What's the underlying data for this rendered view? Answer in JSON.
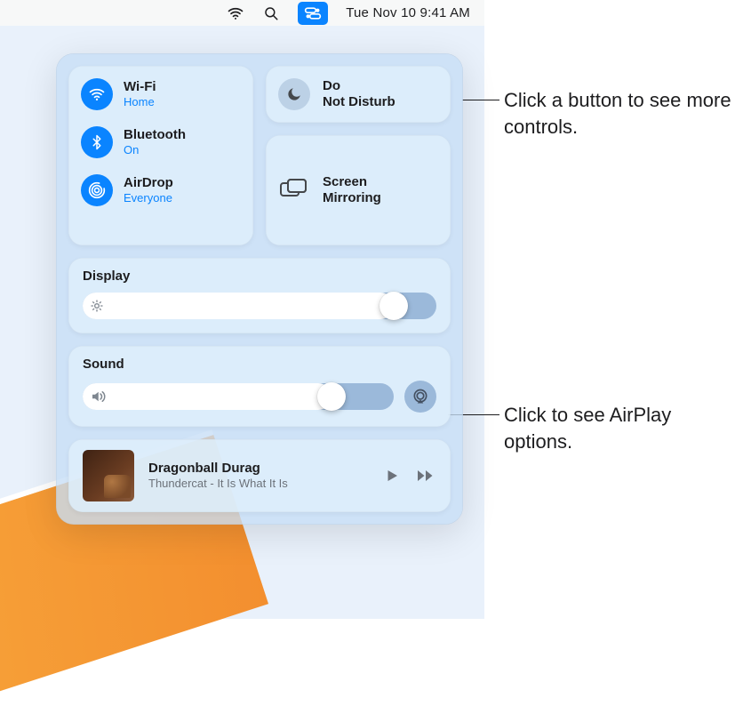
{
  "menubar": {
    "datetime": "Tue Nov 10  9:41 AM"
  },
  "cc": {
    "wifi": {
      "title": "Wi-Fi",
      "sub": "Home"
    },
    "bluetooth": {
      "title": "Bluetooth",
      "sub": "On"
    },
    "airdrop": {
      "title": "AirDrop",
      "sub": "Everyone"
    },
    "dnd": {
      "title": "Do Not Disturb"
    },
    "screen": {
      "title": "Screen Mirroring"
    },
    "display": {
      "label": "Display"
    },
    "sound": {
      "label": "Sound"
    }
  },
  "media": {
    "song": "Dragonball Durag",
    "artist": "Thundercat - It Is What It Is"
  },
  "callouts": {
    "top": "Click a button to see more controls.",
    "bottom": "Click to see AirPlay options."
  },
  "colors": {
    "accent": "#0a84ff",
    "panel": "#c6def6",
    "card": "#deeefc"
  }
}
